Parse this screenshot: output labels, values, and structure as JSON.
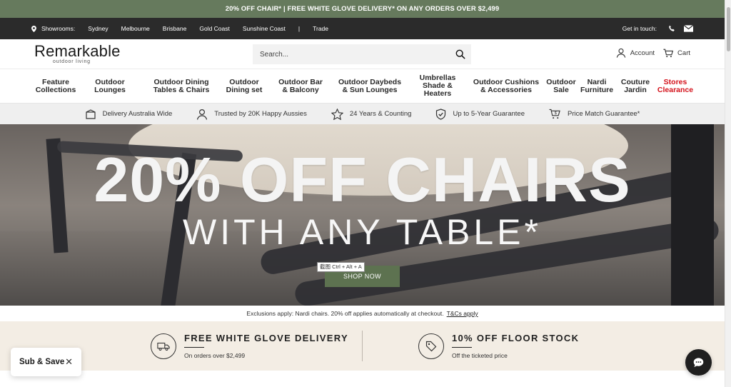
{
  "promo": {
    "text": "20% OFF CHAIR* | FREE WHITE GLOVE DELIVERY* ON ANY ORDERS OVER $2,499"
  },
  "utility": {
    "showrooms_label": "Showrooms:",
    "cities": [
      "Sydney",
      "Melbourne",
      "Brisbane",
      "Gold Coast",
      "Sunshine Coast"
    ],
    "separator": "|",
    "trade": "Trade",
    "contact_label": "Get in touch:"
  },
  "header": {
    "brand": "Remarkable",
    "tagline": "outdoor living",
    "search_placeholder": "Search...",
    "account": "Account",
    "cart": "Cart"
  },
  "nav": {
    "items": [
      "Feature\nCollections",
      "Outdoor\nLounges",
      "Outdoor Dining\nTables & Chairs",
      "Outdoor\nDining set",
      "Outdoor Bar\n& Balcony",
      "Outdoor Daybeds\n& Sun Lounges",
      "Umbrellas\nShade &\nHeaters",
      "Outdoor Cushions\n& Accessories",
      "Outdoor\nSale",
      "Nardi\nFurniture",
      "Couture\nJardin",
      "Stores\nClearance"
    ],
    "highlight_color": "#d4121b"
  },
  "usps": [
    {
      "icon": "box-icon",
      "text": "Delivery Australia Wide"
    },
    {
      "icon": "user-icon",
      "text": "Trusted by 20K Happy Aussies"
    },
    {
      "icon": "star-icon",
      "text": "24 Years & Counting"
    },
    {
      "icon": "shield-check-icon",
      "text": "Up to 5-Year Guarantee"
    },
    {
      "icon": "price-cart-icon",
      "text": "Price Match Guarantee*"
    }
  ],
  "hero": {
    "headline": "20% OFF CHAIRS",
    "subheadline": "WITH ANY TABLE*",
    "cta": "SHOP NOW",
    "tooltip": "截图 Ctrl + Alt + A",
    "cta_color": "#5d7250"
  },
  "exclusions": {
    "text": "Exclusions apply: Nardi chairs. 20% off applies automatically at checkout.",
    "link": "T&Cs apply"
  },
  "offers": [
    {
      "icon": "truck-icon",
      "title": "FREE WHITE GLOVE DELIVERY",
      "desc": "On orders over $2,499"
    },
    {
      "icon": "tag-icon",
      "title": "10% OFF FLOOR STOCK",
      "desc": "Off the ticketed price"
    }
  ],
  "widgets": {
    "subsave": "Sub & Save",
    "close": "✕"
  },
  "colors": {
    "promo_bg": "#667a5d",
    "util_bg": "#2b2b2b",
    "offers_bg": "#f3ede4"
  }
}
